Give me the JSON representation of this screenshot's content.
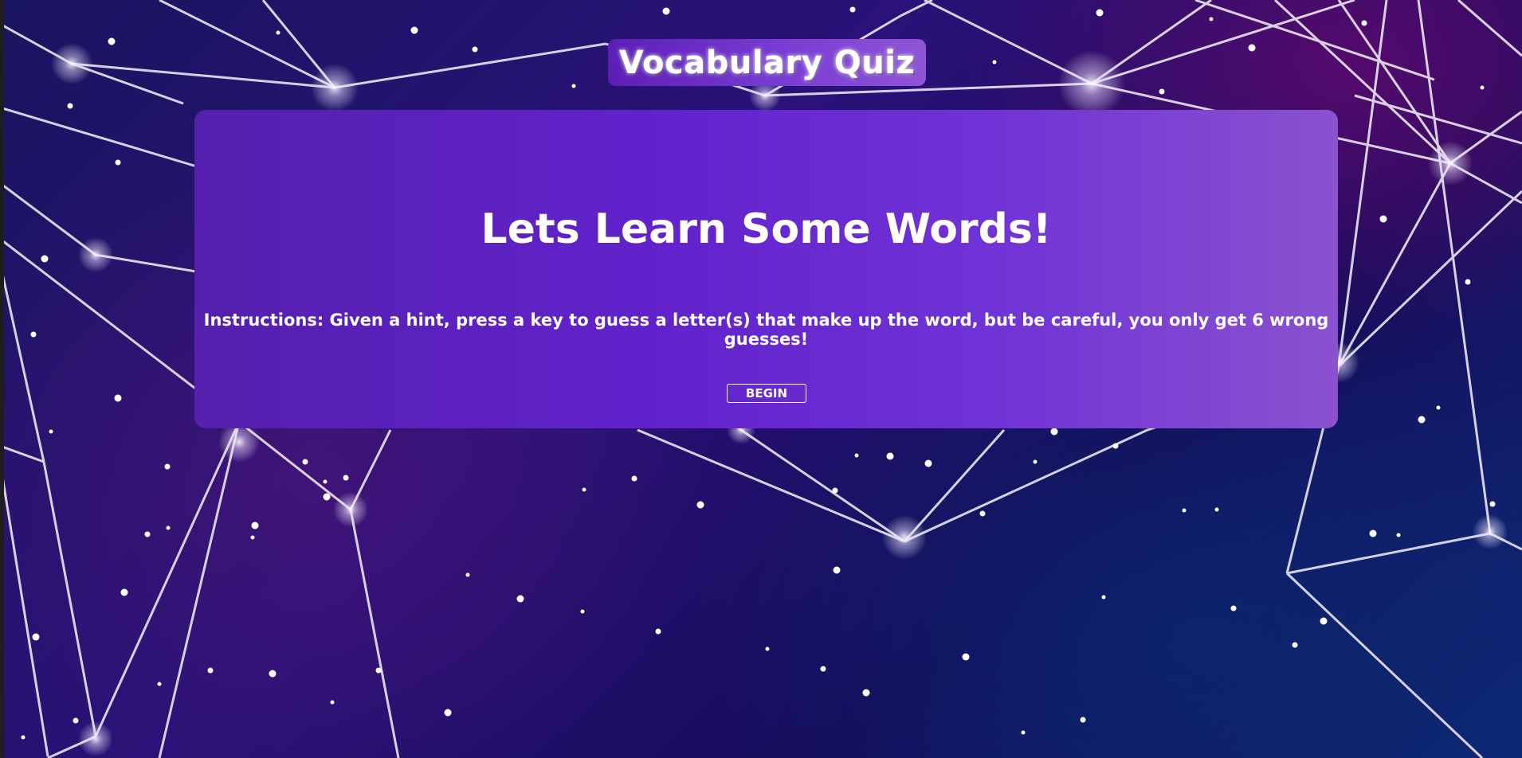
{
  "header": {
    "title": "Vocabulary Quiz"
  },
  "intro": {
    "heading": "Lets Learn Some Words!",
    "instructions": "Instructions: Given a hint, press a key to guess a letter(s) that make up the word, but be careful, you only get 6 wrong guesses!",
    "begin_label": "BEGIN"
  },
  "colors": {
    "card_start": "#5520ad",
    "card_end": "#8a52cf",
    "background_dark": "#160c5a",
    "text": "#ffffff"
  },
  "background": {
    "image": "constellation-network"
  }
}
